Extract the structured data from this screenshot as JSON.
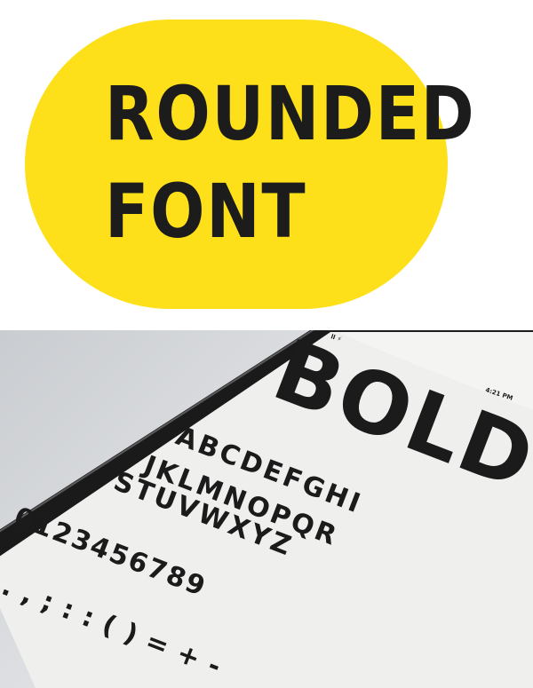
{
  "banner": {
    "line1": "ROUNDED",
    "line2": "FONT",
    "accent_color": "#fde01a",
    "text_color": "#1c1c1c"
  },
  "tablet": {
    "status_left": "ll ⚡",
    "status_time": "4:21 PM",
    "headline": "BOLD",
    "rows": [
      "ABCDEFGHI",
      "JKLMNOPQR",
      "STUVWXYZ",
      "0123456789",
      ". , ; : : ( ) = + -"
    ],
    "bezel_color": "#1a1a1a",
    "screen_color": "#f0f0ee"
  }
}
